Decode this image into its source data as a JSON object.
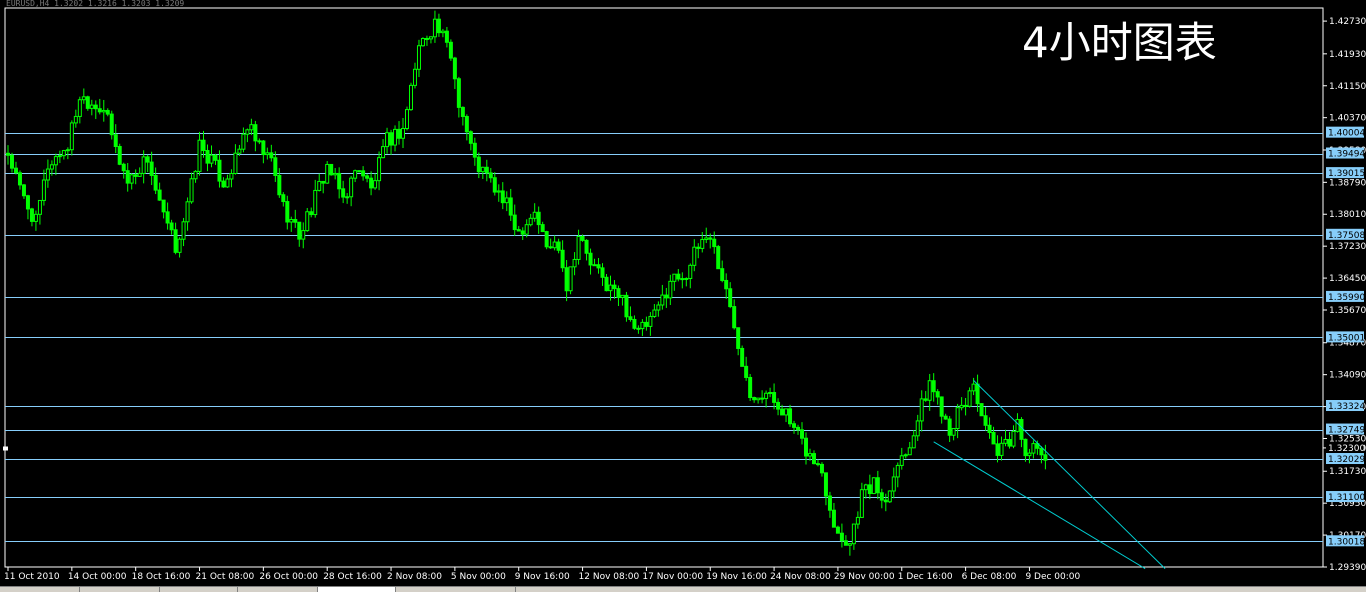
{
  "header_text": "EURUSD,H4 1.3202 1.3216 1.3203 1.3209",
  "colors": {
    "background": "#000000",
    "frame": "#ffffff",
    "candle_up": "#00ff00",
    "candle_down": "#00ff00",
    "level_line": "#87cefa",
    "level_label_bg": "#87cefa",
    "trend_line": "#00ced1",
    "text": "#ffffff"
  },
  "chart_data": {
    "type": "candlestick",
    "title": "4小时图表",
    "ylim": [
      1.2939,
      1.4305
    ],
    "y_ticks": [
      "1.42730",
      "1.41930",
      "1.41150",
      "1.40370",
      "1.39580",
      "1.38790",
      "1.38010",
      "1.37230",
      "1.36450",
      "1.35670",
      "1.34870",
      "1.34090",
      "1.33310",
      "1.32530",
      "1.32300",
      "1.31730",
      "1.30950",
      "1.30170",
      "1.29390"
    ],
    "x_ticks": [
      "11 Oct 2010",
      "14 Oct 00:00",
      "18 Oct 16:00",
      "21 Oct 08:00",
      "26 Oct 00:00",
      "28 Oct 16:00",
      "2 Nov 08:00",
      "5 Nov 00:00",
      "9 Nov 16:00",
      "12 Nov 08:00",
      "17 Nov 00:00",
      "19 Nov 16:00",
      "24 Nov 08:00",
      "29 Nov 00:00",
      "1 Dec 16:00",
      "6 Dec 08:00",
      "9 Dec 00:00"
    ],
    "x_tick_bars": [
      0,
      16,
      32,
      48,
      64,
      80,
      96,
      112,
      128,
      144,
      160,
      176,
      192,
      208,
      224,
      240,
      256
    ],
    "bar_count": 275,
    "horizontal_levels": [
      "1.40004",
      "1.39494",
      "1.39015",
      "1.37508",
      "1.35990",
      "1.35001",
      "1.33324",
      "1.32749",
      "1.32029",
      "1.31100",
      "1.30018"
    ],
    "current_price": "1.32300",
    "price_path": [
      [
        0,
        1.395
      ],
      [
        3,
        1.386
      ],
      [
        7,
        1.378
      ],
      [
        10,
        1.392
      ],
      [
        15,
        1.397
      ],
      [
        18,
        1.409
      ],
      [
        24,
        1.406
      ],
      [
        27,
        1.396
      ],
      [
        30,
        1.388
      ],
      [
        35,
        1.394
      ],
      [
        38,
        1.382
      ],
      [
        42,
        1.372
      ],
      [
        45,
        1.382
      ],
      [
        48,
        1.397
      ],
      [
        51,
        1.393
      ],
      [
        54,
        1.388
      ],
      [
        57,
        1.393
      ],
      [
        60,
        1.402
      ],
      [
        63,
        1.396
      ],
      [
        66,
        1.393
      ],
      [
        69,
        1.382
      ],
      [
        73,
        1.375
      ],
      [
        77,
        1.384
      ],
      [
        80,
        1.392
      ],
      [
        84,
        1.384
      ],
      [
        88,
        1.392
      ],
      [
        91,
        1.386
      ],
      [
        95,
        1.398
      ],
      [
        99,
        1.401
      ],
      [
        103,
        1.421
      ],
      [
        107,
        1.427
      ],
      [
        111,
        1.419
      ],
      [
        113,
        1.408
      ],
      [
        117,
        1.393
      ],
      [
        121,
        1.388
      ],
      [
        125,
        1.382
      ],
      [
        128,
        1.376
      ],
      [
        132,
        1.381
      ],
      [
        135,
        1.372
      ],
      [
        138,
        1.373
      ],
      [
        140,
        1.363
      ],
      [
        143,
        1.375
      ],
      [
        146,
        1.368
      ],
      [
        150,
        1.363
      ],
      [
        154,
        1.359
      ],
      [
        158,
        1.351
      ],
      [
        162,
        1.355
      ],
      [
        166,
        1.364
      ],
      [
        170,
        1.366
      ],
      [
        174,
        1.374
      ],
      [
        176,
        1.375
      ],
      [
        180,
        1.361
      ],
      [
        184,
        1.345
      ],
      [
        186,
        1.337
      ],
      [
        190,
        1.336
      ],
      [
        194,
        1.333
      ],
      [
        197,
        1.327
      ],
      [
        201,
        1.321
      ],
      [
        204,
        1.317
      ],
      [
        206,
        1.309
      ],
      [
        208,
        1.302
      ],
      [
        211,
        1.3
      ],
      [
        214,
        1.312
      ],
      [
        217,
        1.314
      ],
      [
        220,
        1.31
      ],
      [
        222,
        1.318
      ],
      [
        225,
        1.322
      ],
      [
        228,
        1.33
      ],
      [
        231,
        1.339
      ],
      [
        233,
        1.335
      ],
      [
        236,
        1.328
      ],
      [
        240,
        1.334
      ],
      [
        242,
        1.339
      ],
      [
        245,
        1.327
      ],
      [
        248,
        1.321
      ],
      [
        251,
        1.325
      ],
      [
        253,
        1.329
      ],
      [
        255,
        1.323
      ],
      [
        258,
        1.322
      ],
      [
        260,
        1.321
      ]
    ],
    "trend_lines": [
      {
        "from": [
          242,
          1.3395
        ],
        "to": [
          290,
          1.2935
        ]
      },
      {
        "from": [
          232,
          1.3245
        ],
        "to": [
          285,
          1.2935
        ]
      }
    ]
  }
}
